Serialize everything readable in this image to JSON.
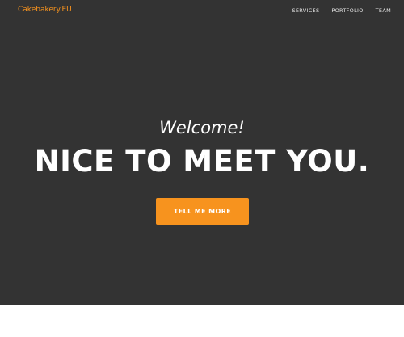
{
  "navbar": {
    "brand": "Cakebakery.EU",
    "links": [
      {
        "label": "SERVICES"
      },
      {
        "label": "PORTFOLIO"
      },
      {
        "label": "TEAM"
      }
    ]
  },
  "hero": {
    "subheading": "Welcome!",
    "heading": "NICE TO MEET YOU.",
    "cta_label": "TELL ME MORE"
  },
  "colors": {
    "accent": "#f7931e",
    "hero_background": "#333333",
    "text": "#ffffff",
    "page_background": "#ffffff"
  }
}
